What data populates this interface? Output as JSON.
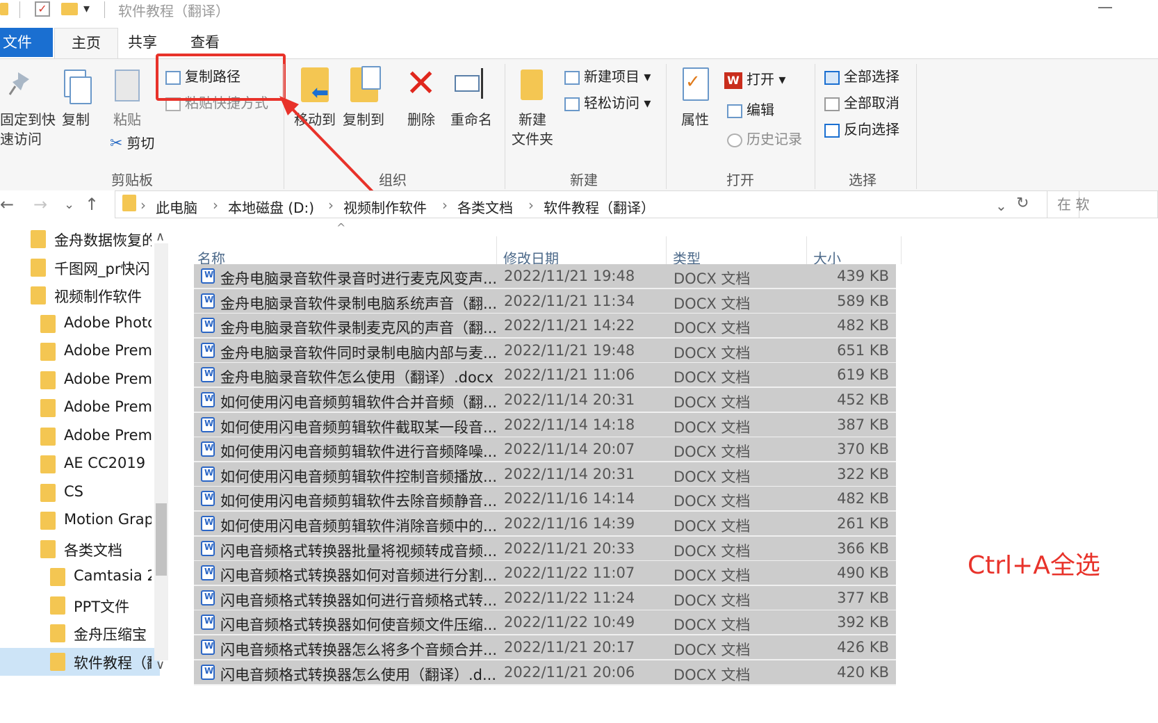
{
  "window": {
    "title": "软件教程（翻译）"
  },
  "tabs": {
    "file": "文件",
    "home": "主页",
    "share": "共享",
    "view": "查看"
  },
  "ribbon": {
    "clipboard": {
      "pin": "固定到快速访问",
      "pin_line1": "固定到快",
      "pin_line2": "速访问",
      "copy": "复制",
      "paste": "粘贴",
      "copy_path": "复制路径",
      "paste_shortcut": "粘贴快捷方式",
      "cut": "剪切",
      "group": "剪贴板"
    },
    "organize": {
      "move_to": "移动到",
      "copy_to": "复制到",
      "delete": "删除",
      "rename": "重命名",
      "group": "组织"
    },
    "new": {
      "new_folder_line1": "新建",
      "new_folder_line2": "文件夹",
      "new_item": "新建项目 ▾",
      "easy_access": "轻松访问 ▾",
      "group": "新建"
    },
    "open": {
      "properties": "属性",
      "open": "打开 ▾",
      "edit": "编辑",
      "history": "历史记录",
      "group": "打开"
    },
    "select": {
      "select_all": "全部选择",
      "select_none": "全部取消",
      "invert": "反向选择",
      "group": "选择"
    }
  },
  "address": {
    "crumbs": [
      "此电脑",
      "本地磁盘 (D:)",
      "视频制作软件",
      "各类文档",
      "软件教程（翻译）"
    ],
    "search_placeholder": "在 软"
  },
  "tree": [
    {
      "label": "金舟数据恢复的",
      "indent": 0
    },
    {
      "label": "千图网_pr快闪",
      "indent": 0
    },
    {
      "label": "视频制作软件",
      "indent": 0
    },
    {
      "label": "Adobe Photo",
      "indent": 1
    },
    {
      "label": "Adobe Premi",
      "indent": 1
    },
    {
      "label": "Adobe Premi",
      "indent": 1
    },
    {
      "label": "Adobe Premi",
      "indent": 1
    },
    {
      "label": "Adobe Premi",
      "indent": 1
    },
    {
      "label": "AE CC2019",
      "indent": 1
    },
    {
      "label": "CS",
      "indent": 1
    },
    {
      "label": "Motion Grap",
      "indent": 1
    },
    {
      "label": "各类文档",
      "indent": 1
    },
    {
      "label": "Camtasia 2(",
      "indent": 2
    },
    {
      "label": "PPT文件",
      "indent": 2
    },
    {
      "label": "金舟压缩宝",
      "indent": 2
    },
    {
      "label": "软件教程（翻",
      "indent": 2
    }
  ],
  "columns": {
    "name": "名称",
    "date": "修改日期",
    "type": "类型",
    "size": "大小"
  },
  "files": [
    {
      "name": "金舟电脑录音软件录音时进行麦克风变声...",
      "date": "2022/11/21 19:48",
      "type": "DOCX 文档",
      "size": "439 KB"
    },
    {
      "name": "金舟电脑录音软件录制电脑系统声音（翻...",
      "date": "2022/11/21 11:34",
      "type": "DOCX 文档",
      "size": "589 KB"
    },
    {
      "name": "金舟电脑录音软件录制麦克风的声音（翻...",
      "date": "2022/11/21 14:22",
      "type": "DOCX 文档",
      "size": "482 KB"
    },
    {
      "name": "金舟电脑录音软件同时录制电脑内部与麦...",
      "date": "2022/11/21 19:48",
      "type": "DOCX 文档",
      "size": "651 KB"
    },
    {
      "name": "金舟电脑录音软件怎么使用（翻译）.docx",
      "date": "2022/11/21 11:06",
      "type": "DOCX 文档",
      "size": "619 KB"
    },
    {
      "name": "如何使用闪电音频剪辑软件合并音频（翻...",
      "date": "2022/11/14 20:31",
      "type": "DOCX 文档",
      "size": "452 KB"
    },
    {
      "name": "如何使用闪电音频剪辑软件截取某一段音...",
      "date": "2022/11/14 14:18",
      "type": "DOCX 文档",
      "size": "387 KB"
    },
    {
      "name": "如何使用闪电音频剪辑软件进行音频降噪...",
      "date": "2022/11/14 20:07",
      "type": "DOCX 文档",
      "size": "370 KB"
    },
    {
      "name": "如何使用闪电音频剪辑软件控制音频播放...",
      "date": "2022/11/14 20:31",
      "type": "DOCX 文档",
      "size": "322 KB"
    },
    {
      "name": "如何使用闪电音频剪辑软件去除音频静音...",
      "date": "2022/11/16 14:14",
      "type": "DOCX 文档",
      "size": "482 KB"
    },
    {
      "name": "如何使用闪电音频剪辑软件消除音频中的...",
      "date": "2022/11/16 14:39",
      "type": "DOCX 文档",
      "size": "261 KB"
    },
    {
      "name": "闪电音频格式转换器批量将视频转成音频...",
      "date": "2022/11/21 20:33",
      "type": "DOCX 文档",
      "size": "366 KB"
    },
    {
      "name": "闪电音频格式转换器如何对音频进行分割...",
      "date": "2022/11/22 11:07",
      "type": "DOCX 文档",
      "size": "490 KB"
    },
    {
      "name": "闪电音频格式转换器如何进行音频格式转...",
      "date": "2022/11/22 11:24",
      "type": "DOCX 文档",
      "size": "377 KB"
    },
    {
      "name": "闪电音频格式转换器如何使音频文件压缩...",
      "date": "2022/11/22 10:49",
      "type": "DOCX 文档",
      "size": "392 KB"
    },
    {
      "name": "闪电音频格式转换器怎么将多个音频合并...",
      "date": "2022/11/21 20:17",
      "type": "DOCX 文档",
      "size": "426 KB"
    },
    {
      "name": "闪电音频格式转换器怎么使用（翻译）.d...",
      "date": "2022/11/21 20:06",
      "type": "DOCX 文档",
      "size": "420 KB"
    }
  ],
  "annotation": {
    "text": "Ctrl+A全选",
    "color": "#e8322a"
  },
  "colors": {
    "accent": "#1a6fd1",
    "folder": "#f4c652",
    "selection": "#cccccc"
  }
}
